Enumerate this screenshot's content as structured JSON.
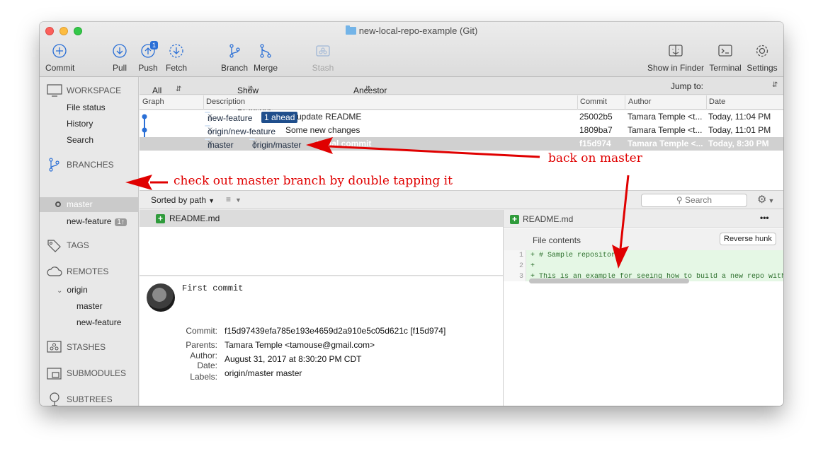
{
  "window": {
    "title": "new-local-repo-example (Git)"
  },
  "toolbar": {
    "commit": "Commit",
    "pull": "Pull",
    "push": "Push",
    "push_badge": "1",
    "fetch": "Fetch",
    "branch": "Branch",
    "merge": "Merge",
    "stash": "Stash",
    "show_in_finder": "Show in Finder",
    "terminal": "Terminal",
    "settings": "Settings"
  },
  "sidebar": {
    "workspace": "WORKSPACE",
    "workspace_items": [
      "File status",
      "History",
      "Search"
    ],
    "branches": "BRANCHES",
    "branch_items": [
      {
        "name": "master",
        "selected": true
      },
      {
        "name": "new-feature",
        "badge": "1↑"
      }
    ],
    "tags": "TAGS",
    "remotes": "REMOTES",
    "remote_name": "origin",
    "remote_branches": [
      "master",
      "new-feature"
    ],
    "stashes": "STASHES",
    "submodules": "SUBMODULES",
    "subtrees": "SUBTREES"
  },
  "filter": {
    "branches": "All Branches",
    "remote": "Show Remote Branches",
    "order": "Ancestor Order",
    "jump_to": "Jump to:"
  },
  "columns": {
    "graph": "Graph",
    "description": "Description",
    "commit": "Commit",
    "author": "Author",
    "date": "Date"
  },
  "commits": [
    {
      "refs": [
        "new-feature"
      ],
      "ahead": "1 ahead",
      "message": "update README",
      "hash": "25002b5",
      "author": "Tamara Temple <t...",
      "date": "Today, 11:04 PM"
    },
    {
      "refs": [
        "origin/new-feature"
      ],
      "message": "Some new changes",
      "hash": "1809ba7",
      "author": "Tamara Temple <t...",
      "date": "Today, 11:01 PM"
    },
    {
      "refs": [
        "master",
        "origin/master"
      ],
      "message": "Initial commit",
      "hash": "f15d974",
      "author": "Tamara Temple <...",
      "date": "Today, 8:30 PM",
      "selected": true
    }
  ],
  "filebar": {
    "sort": "Sorted by path",
    "search_placeholder": "Search"
  },
  "files": [
    "README.md"
  ],
  "commit_detail": {
    "message": "First commit",
    "labels": {
      "commit": "Commit:",
      "parents": "Parents:",
      "author": "Author:",
      "date": "Date:",
      "labels": "Labels:"
    },
    "commit": "f15d97439efa785e193e4659d2a910e5c05d621c [f15d974]",
    "parents": "Tamara Temple <tamouse@gmail.com>",
    "author_date": "August 31, 2017 at 8:30:20 PM CDT",
    "labels_value": "origin/master master"
  },
  "diff": {
    "file": "README.md",
    "more": "•••",
    "section": "File contents",
    "reverse_hunk": "Reverse hunk",
    "lines": [
      {
        "n": "1",
        "text": "+ # Sample repository"
      },
      {
        "n": "2",
        "text": "+"
      },
      {
        "n": "3",
        "text": "+ This is an example for seeing how to build a new repo with"
      }
    ]
  },
  "annotations": {
    "checkout": "check out master branch by double tapping it",
    "back_on_master": "back on master"
  },
  "colors": {
    "accent": "#1f4e8c",
    "annotation": "#e00000",
    "added": "#2f9b3b"
  }
}
